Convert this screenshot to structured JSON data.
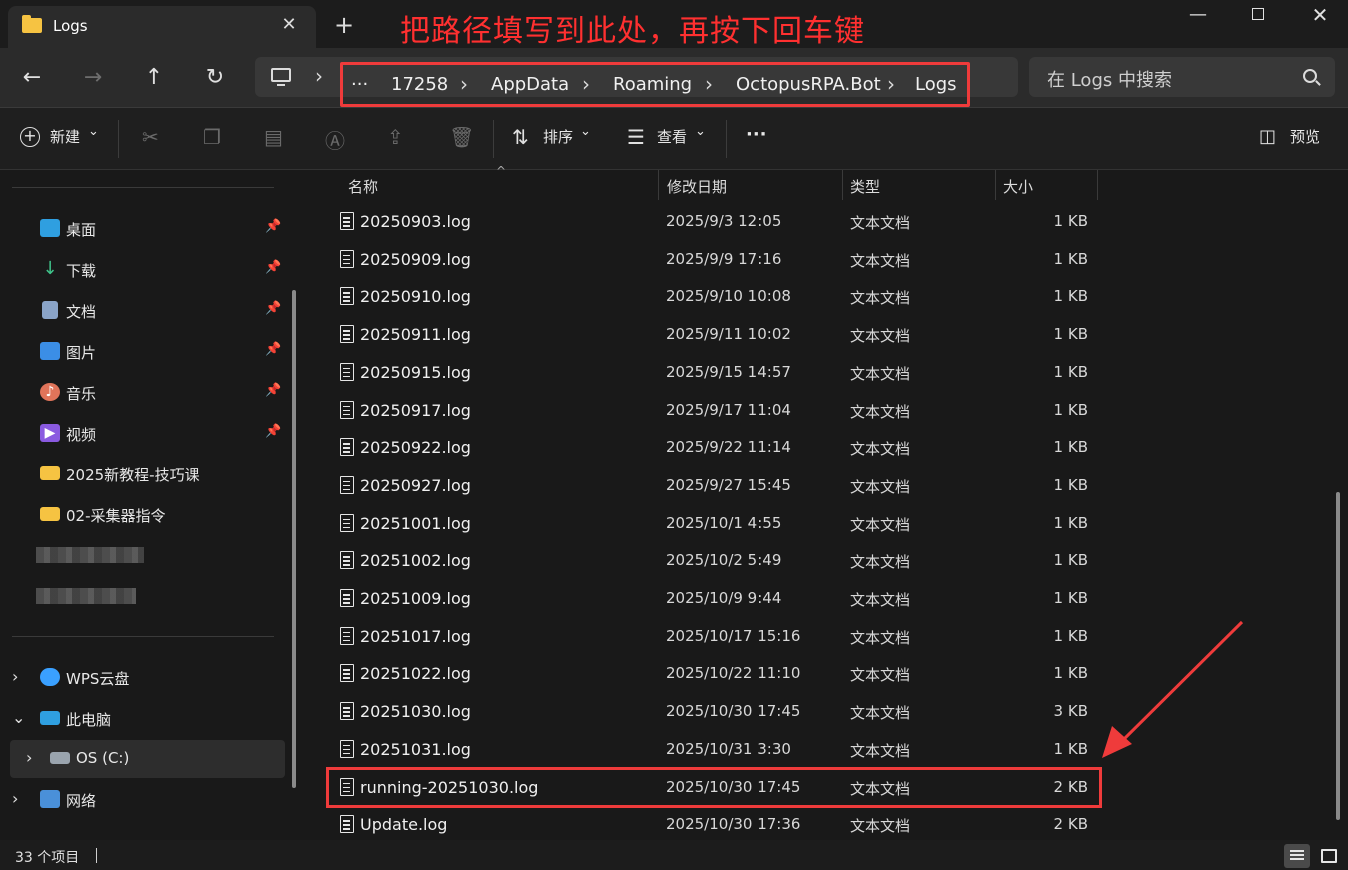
{
  "window": {
    "tab_title": "Logs",
    "tab_close": "✕",
    "new_tab": "+",
    "annotation": "把路径填写到此处，再按下回车键",
    "minimize": "—",
    "close": "✕"
  },
  "address": {
    "overflow": "···",
    "crumbs": [
      "17258",
      "AppData",
      "Roaming",
      "OctopusRPA.Bot",
      "Logs"
    ],
    "search_placeholder": "在 Logs 中搜索"
  },
  "toolbar": {
    "new_label": "新建",
    "sort_label": "排序",
    "view_label": "查看",
    "more": "···",
    "preview_label": "预览"
  },
  "sidebar": {
    "quick_access": [
      {
        "label": "桌面",
        "icon": "desktop-icon"
      },
      {
        "label": "下载",
        "icon": "download-icon"
      },
      {
        "label": "文档",
        "icon": "document-icon"
      },
      {
        "label": "图片",
        "icon": "pictures-icon"
      },
      {
        "label": "音乐",
        "icon": "music-icon"
      },
      {
        "label": "视频",
        "icon": "video-icon"
      },
      {
        "label": "2025新教程-技巧课",
        "icon": "folder-icon"
      },
      {
        "label": "02-采集器指令",
        "icon": "folder-icon"
      }
    ],
    "locations": [
      {
        "label": "WPS云盘",
        "icon": "cloud-icon"
      },
      {
        "label": "此电脑",
        "icon": "pc-icon"
      },
      {
        "label": "OS (C:)",
        "icon": "drive-icon"
      },
      {
        "label": "网络",
        "icon": "network-icon"
      }
    ]
  },
  "columns": {
    "name": "名称",
    "date": "修改日期",
    "type": "类型",
    "size": "大小"
  },
  "files": [
    {
      "name": "20250903.log",
      "date": "2025/9/3 12:05",
      "type": "文本文档",
      "size": "1 KB"
    },
    {
      "name": "20250909.log",
      "date": "2025/9/9 17:16",
      "type": "文本文档",
      "size": "1 KB"
    },
    {
      "name": "20250910.log",
      "date": "2025/9/10 10:08",
      "type": "文本文档",
      "size": "1 KB"
    },
    {
      "name": "20250911.log",
      "date": "2025/9/11 10:02",
      "type": "文本文档",
      "size": "1 KB"
    },
    {
      "name": "20250915.log",
      "date": "2025/9/15 14:57",
      "type": "文本文档",
      "size": "1 KB"
    },
    {
      "name": "20250917.log",
      "date": "2025/9/17 11:04",
      "type": "文本文档",
      "size": "1 KB"
    },
    {
      "name": "20250922.log",
      "date": "2025/9/22 11:14",
      "type": "文本文档",
      "size": "1 KB"
    },
    {
      "name": "20250927.log",
      "date": "2025/9/27 15:45",
      "type": "文本文档",
      "size": "1 KB"
    },
    {
      "name": "20251001.log",
      "date": "2025/10/1 4:55",
      "type": "文本文档",
      "size": "1 KB"
    },
    {
      "name": "20251002.log",
      "date": "2025/10/2 5:49",
      "type": "文本文档",
      "size": "1 KB"
    },
    {
      "name": "20251009.log",
      "date": "2025/10/9 9:44",
      "type": "文本文档",
      "size": "1 KB"
    },
    {
      "name": "20251017.log",
      "date": "2025/10/17 15:16",
      "type": "文本文档",
      "size": "1 KB"
    },
    {
      "name": "20251022.log",
      "date": "2025/10/22 11:10",
      "type": "文本文档",
      "size": "1 KB"
    },
    {
      "name": "20251030.log",
      "date": "2025/10/30 17:45",
      "type": "文本文档",
      "size": "3 KB"
    },
    {
      "name": "20251031.log",
      "date": "2025/10/31 3:30",
      "type": "文本文档",
      "size": "1 KB"
    },
    {
      "name": "running-20251030.log",
      "date": "2025/10/30 17:45",
      "type": "文本文档",
      "size": "2 KB",
      "highlighted": true
    },
    {
      "name": "Update.log",
      "date": "2025/10/30 17:36",
      "type": "文本文档",
      "size": "2 KB"
    }
  ],
  "status": {
    "item_count": "33 个项目"
  },
  "colors": {
    "annotation_red": "#ef3b3b",
    "folder_yellow": "#f6c342",
    "background": "#191919"
  }
}
